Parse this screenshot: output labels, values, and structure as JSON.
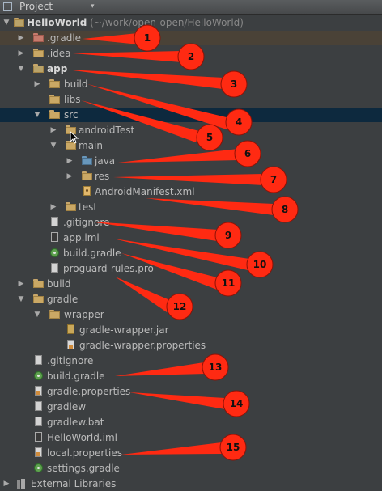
{
  "panel": {
    "title": "Project",
    "caret": "▾"
  },
  "tree": [
    {
      "name": "tree-row-helloworld",
      "label": "HelloWorld",
      "path": " (~/work/open-open/HelloWorld)",
      "icon": "module-folder-icon",
      "expanded": true
    },
    {
      "name": "tree-row-gradle-dir",
      "label": ".gradle",
      "icon": "folder-excluded-icon",
      "expanded": false
    },
    {
      "name": "tree-row-idea",
      "label": ".idea",
      "icon": "folder-icon",
      "expanded": false
    },
    {
      "name": "tree-row-app",
      "label": "app",
      "icon": "module-folder-icon",
      "expanded": true
    },
    {
      "name": "tree-row-app-build",
      "label": "build",
      "icon": "folder-icon",
      "expanded": false
    },
    {
      "name": "tree-row-libs",
      "label": "libs",
      "icon": "folder-icon"
    },
    {
      "name": "tree-row-src",
      "label": "src",
      "icon": "folder-icon",
      "expanded": true
    },
    {
      "name": "tree-row-androidtest",
      "label": "androidTest",
      "icon": "folder-icon",
      "expanded": false
    },
    {
      "name": "tree-row-main",
      "label": "main",
      "icon": "folder-icon",
      "expanded": true
    },
    {
      "name": "tree-row-java",
      "label": "java",
      "icon": "source-folder-icon",
      "expanded": false
    },
    {
      "name": "tree-row-res",
      "label": "res",
      "icon": "resource-folder-icon",
      "expanded": false
    },
    {
      "name": "tree-row-manifest",
      "label": "AndroidManifest.xml",
      "icon": "xml-file-icon"
    },
    {
      "name": "tree-row-test",
      "label": "test",
      "icon": "folder-icon",
      "expanded": false
    },
    {
      "name": "tree-row-app-gitignore",
      "label": ".gitignore",
      "icon": "text-file-icon"
    },
    {
      "name": "tree-row-app-iml",
      "label": "app.iml",
      "icon": "iml-file-icon"
    },
    {
      "name": "tree-row-app-build-gradle",
      "label": "build.gradle",
      "icon": "gradle-icon"
    },
    {
      "name": "tree-row-proguard",
      "label": "proguard-rules.pro",
      "icon": "text-file-icon"
    },
    {
      "name": "tree-row-build",
      "label": "build",
      "icon": "folder-icon",
      "expanded": false
    },
    {
      "name": "tree-row-gradle",
      "label": "gradle",
      "icon": "folder-icon",
      "expanded": true
    },
    {
      "name": "tree-row-wrapper",
      "label": "wrapper",
      "icon": "folder-icon",
      "expanded": true
    },
    {
      "name": "tree-row-wrapper-jar",
      "label": "gradle-wrapper.jar",
      "icon": "jar-file-icon"
    },
    {
      "name": "tree-row-wrapper-props",
      "label": "gradle-wrapper.properties",
      "icon": "properties-file-icon"
    },
    {
      "name": "tree-row-gitignore",
      "label": ".gitignore",
      "icon": "text-file-icon"
    },
    {
      "name": "tree-row-build-gradle",
      "label": "build.gradle",
      "icon": "gradle-icon"
    },
    {
      "name": "tree-row-gradle-props",
      "label": "gradle.properties",
      "icon": "properties-file-icon"
    },
    {
      "name": "tree-row-gradlew",
      "label": "gradlew",
      "icon": "text-file-icon"
    },
    {
      "name": "tree-row-gradlew-bat",
      "label": "gradlew.bat",
      "icon": "text-file-icon"
    },
    {
      "name": "tree-row-helloworld-iml",
      "label": "HelloWorld.iml",
      "icon": "iml-file-icon"
    },
    {
      "name": "tree-row-local-props",
      "label": "local.properties",
      "icon": "properties-file-icon"
    },
    {
      "name": "tree-row-settings-gradle",
      "label": "settings.gradle",
      "icon": "gradle-icon"
    },
    {
      "name": "tree-row-external-libraries",
      "label": "External Libraries",
      "icon": "library-icon",
      "expanded": false
    }
  ],
  "callouts": [
    "1",
    "2",
    "3",
    "4",
    "5",
    "6",
    "7",
    "8",
    "9",
    "10",
    "11",
    "12",
    "13",
    "14",
    "15"
  ],
  "colors": {
    "callout_fill": "#ff2a12",
    "callout_stroke": "#8c1106",
    "selection": "#0d293e"
  }
}
